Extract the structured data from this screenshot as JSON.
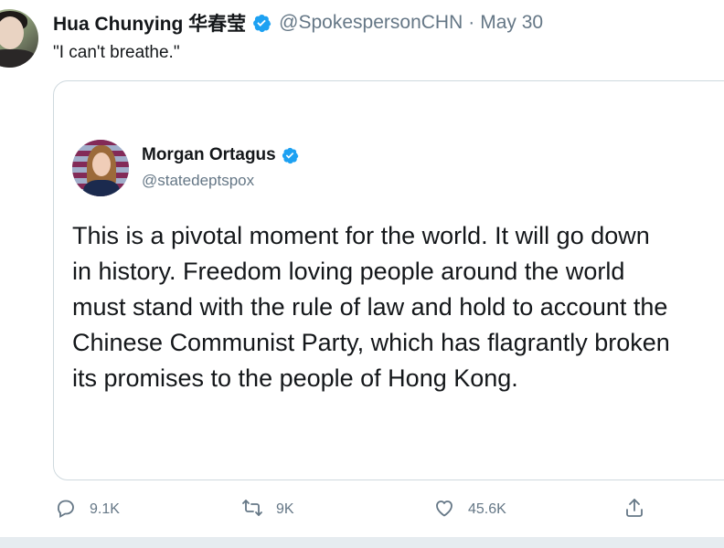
{
  "tweet": {
    "author_name": "Hua Chunying 华春莹",
    "handle": "@SpokespersonCHN",
    "separator": "·",
    "date": "May 30",
    "text": "\"I can't breathe.\""
  },
  "quoted_tweet": {
    "author_name": "Morgan Ortagus",
    "handle": "@statedeptspox",
    "lines": [
      "This is a pivotal moment for the world. It will go down",
      "in history. Freedom loving people around the world",
      "must stand with the rule of law and hold to account the",
      "Chinese Communist Party, which has flagrantly broken",
      "its promises to the people of Hong Kong."
    ]
  },
  "actions": {
    "reply": {
      "icon": "reply-icon",
      "count": "9.1K"
    },
    "retweet": {
      "icon": "retweet-icon",
      "count": "9K"
    },
    "like": {
      "icon": "heart-icon",
      "count": "45.6K"
    },
    "share": {
      "icon": "share-icon"
    }
  },
  "colors": {
    "verified_blue": "#1da1f2",
    "muted_text": "#657786",
    "border": "#cfd9de"
  }
}
